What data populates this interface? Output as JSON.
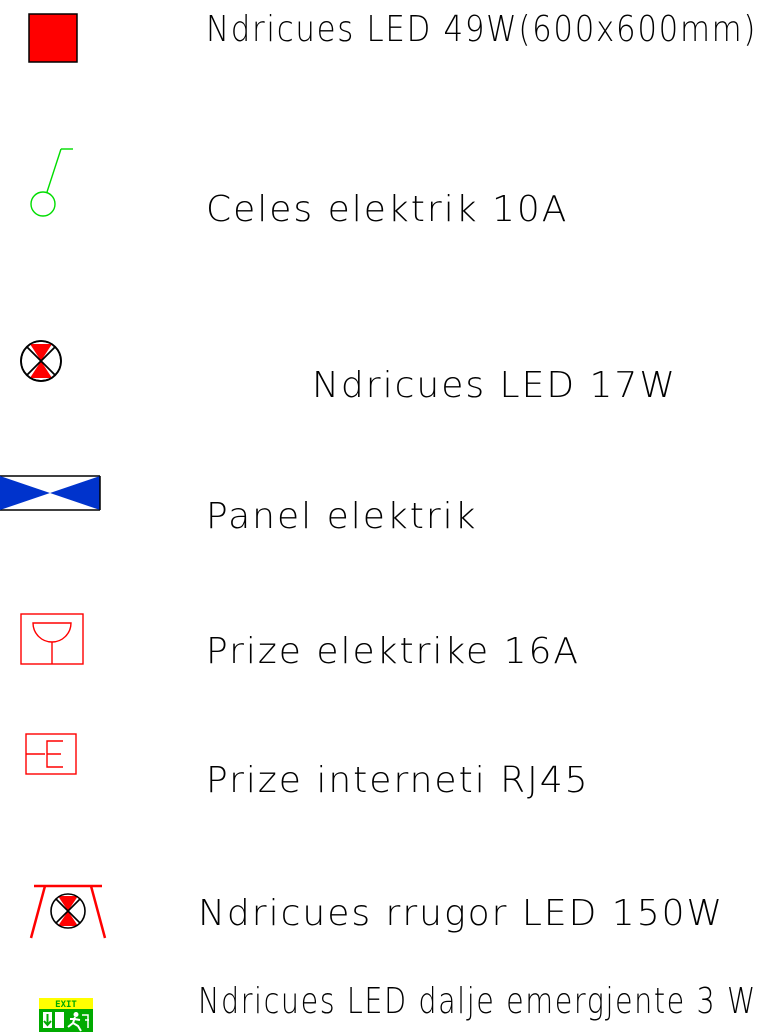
{
  "legend": {
    "items": [
      {
        "symbol": "led-panel-square-icon",
        "color": "#ff0000",
        "label": "Ndricues LED 49W(600x600mm)"
      },
      {
        "symbol": "light-switch-icon",
        "color": "#00dd00",
        "label": "Celes elektrik 10A"
      },
      {
        "symbol": "led-round-light-icon",
        "color": "#ff0000",
        "label": "Ndricues LED 17W"
      },
      {
        "symbol": "electric-panel-icon",
        "color": "#0033cc",
        "label": "Panel elektrik"
      },
      {
        "symbol": "power-socket-icon",
        "color": "#ff0000",
        "label": "Prize elektrike 16A"
      },
      {
        "symbol": "network-socket-icon",
        "color": "#ff0000",
        "label": "Prize interneti RJ45"
      },
      {
        "symbol": "street-light-icon",
        "color": "#ff0000",
        "label": "Ndricues rrugor LED 150W"
      },
      {
        "symbol": "emergency-exit-light-icon",
        "color": "#00aa00",
        "label": "Ndricues LED dalje emergjente 3 W"
      }
    ],
    "exit_sign_text": "EXIT"
  }
}
